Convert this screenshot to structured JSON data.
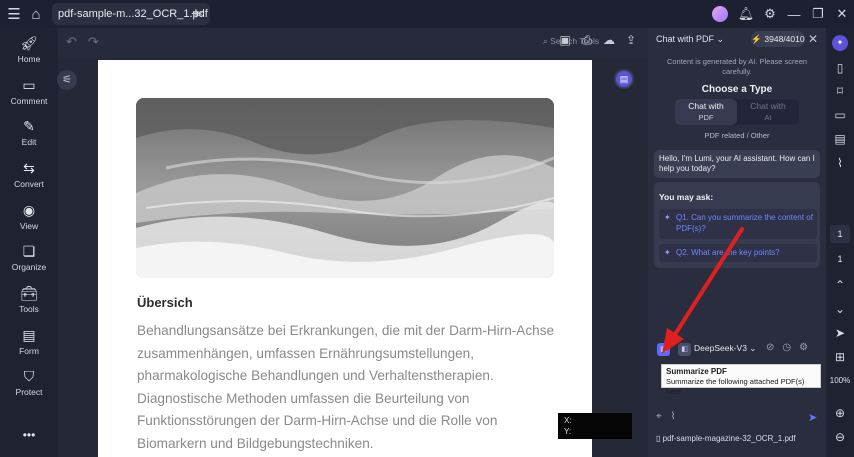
{
  "titlebar": {
    "tab_title": "pdf-sample-m...32_OCR_1.pdf",
    "tab_close": "×",
    "new_tab": "+"
  },
  "left_nav": [
    {
      "label": "Home",
      "icon": "rocket-icon"
    },
    {
      "label": "Comment",
      "icon": "comment-icon"
    },
    {
      "label": "Edit",
      "icon": "edit-icon"
    },
    {
      "label": "Convert",
      "icon": "convert-icon"
    },
    {
      "label": "View",
      "icon": "eye-icon"
    },
    {
      "label": "Organize",
      "icon": "organize-icon"
    },
    {
      "label": "Tools",
      "icon": "toolbox-icon"
    },
    {
      "label": "Form",
      "icon": "form-icon"
    },
    {
      "label": "Protect",
      "icon": "shield-icon"
    }
  ],
  "toolbar": {
    "search_label": "Search Tools"
  },
  "document": {
    "heading": "Übersich",
    "lines": [
      "Behandlungsansätze bei Erkrankungen, die mit der Darm-Hirn-Achse",
      "zusammenhängen, umfassen Ernährungsumstellungen,",
      "pharmakologische Behandlungen und Verhaltenstherapien.",
      "Diagnostische Methoden umfassen die Beurteilung von",
      "Funktionsstörungen der Darm-Hirn-Achse und die Rolle von",
      "Biomarkern und Bildgebungstechniken."
    ],
    "coords_x": "X:",
    "coords_y": "Y:"
  },
  "chat": {
    "mode": "Chat with PDF",
    "credits": "3948/4010",
    "disclaimer": "Content is generated by AI. Please screen carefully.",
    "choose_title": "Choose a Type",
    "seg_active_1": "Chat with",
    "seg_active_2": "PDF",
    "seg_inactive_1": "Chat with",
    "seg_inactive_2": "AI",
    "seg_sub": "PDF related / Other",
    "greeting": "Hello, I'm Lumi, your AI assistant. How can I help you today?",
    "ask_title": "You may ask:",
    "q1": "Q1. Can you summarize the content of PDF(s)?",
    "q2": "Q2. What are the key points?",
    "model": "DeepSeek-V3",
    "tooltip_title": "Summarize PDF",
    "tooltip_text": "Summarize the following attached PDF(s) here.",
    "file": "pdf-sample-magazine-32_OCR_1.pdf"
  },
  "rail": {
    "page_current": "1",
    "page_total": "1",
    "zoom": "100%"
  },
  "colors": {
    "accent": "#5b54d9",
    "link": "#6f87ff",
    "annotation_arrow": "#e02020"
  }
}
